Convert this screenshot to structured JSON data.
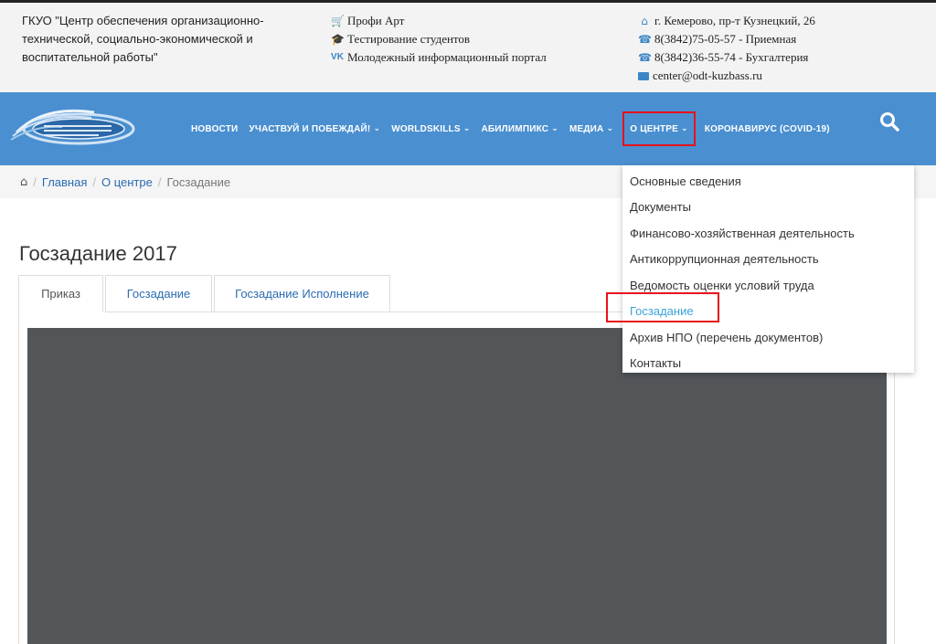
{
  "org": {
    "lines": [
      "ГКУО \"Центр обеспечения организационно-",
      "технической, социально-экономической и",
      "воспитательной работы\""
    ]
  },
  "links": [
    {
      "icon": "cart-icon",
      "label": "Профи Арт"
    },
    {
      "icon": "graduation-cap-icon",
      "label": "Тестирование студентов"
    },
    {
      "icon": "vk-icon",
      "label": "Молодежный информационный портал"
    }
  ],
  "contacts": {
    "address": "г. Кемерово, пр-т Кузнецкий, 26",
    "phone1": "8(3842)75-05-57 - Приемная",
    "phone2": "8(3842)36-55-74 - Бухгалтерия",
    "email": "center@odt-kuzbass.ru"
  },
  "nav": {
    "items": [
      {
        "label": "НОВОСТИ",
        "caret": false
      },
      {
        "label": "УЧАСТВУЙ И ПОБЕЖДАЙ!",
        "caret": true
      },
      {
        "label": "WORLDSKILLS",
        "caret": true
      },
      {
        "label": "АБИЛИМПИКС",
        "caret": true
      },
      {
        "label": "МЕДИА",
        "caret": true
      },
      {
        "label": "О ЦЕНТРЕ",
        "caret": true,
        "active": true
      },
      {
        "label": "КОРОНАВИРУС (COVID-19)",
        "caret": false
      }
    ]
  },
  "breadcrumb": {
    "home": "Главная",
    "section": "О центре",
    "current": "Госзадание"
  },
  "page": {
    "title": "Госзадание 2017",
    "tabs": [
      "Приказ",
      "Госзадание",
      "Госзадание Исполнение"
    ]
  },
  "dropdown": {
    "items": [
      "Основные сведения",
      "Документы",
      "Финансово-хозяйственная деятельность",
      "Антикоррупционная деятельность",
      "Ведомость оценки условий труда",
      "Госзадание",
      "Архив НПО (перечень документов)",
      "Контакты"
    ],
    "selected_index": 5
  },
  "colors": {
    "nav": "#4a8fd0",
    "link": "#2a6cb0",
    "highlight": "#e8111b",
    "selected": "#3aa2d8",
    "viewer": "#525659"
  }
}
